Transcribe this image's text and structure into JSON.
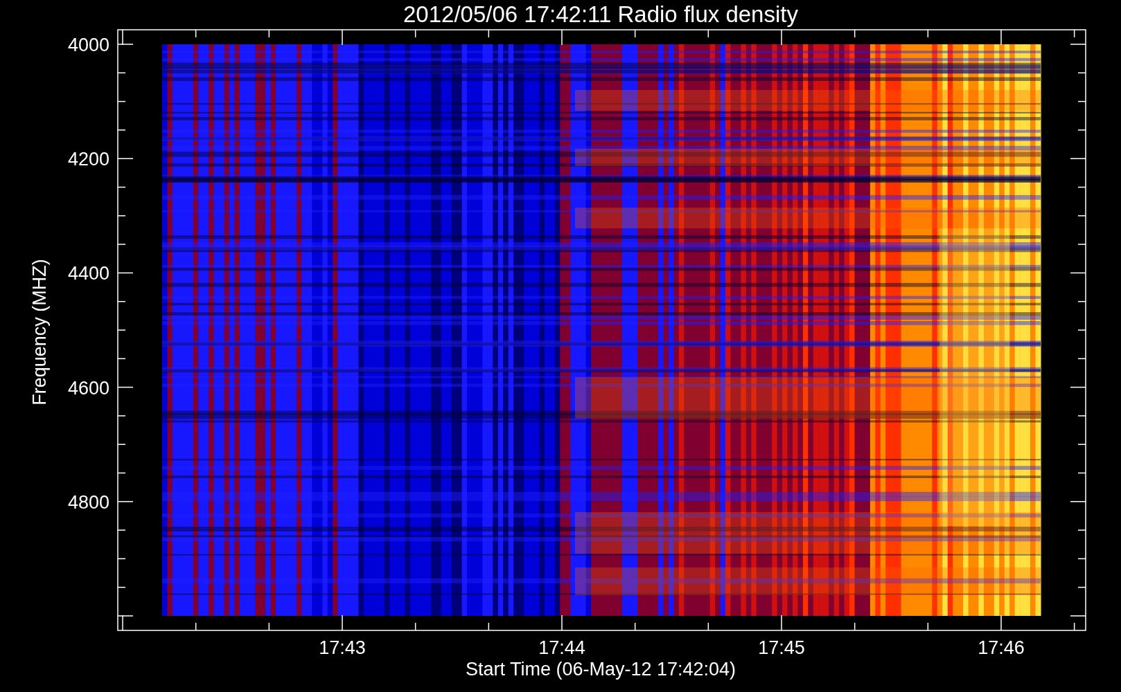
{
  "plot": {
    "title": "2012/05/06 17:42:11 Radio flux density",
    "ylabel": "Frequency (MHZ)",
    "xlabel": "Start Time (06-May-12 17:42:04)",
    "yticks": [
      "4000",
      "4200",
      "4400",
      "4600",
      "4800"
    ],
    "xticks": [
      "17:43",
      "17:44",
      "17:45",
      "17:46"
    ]
  }
}
